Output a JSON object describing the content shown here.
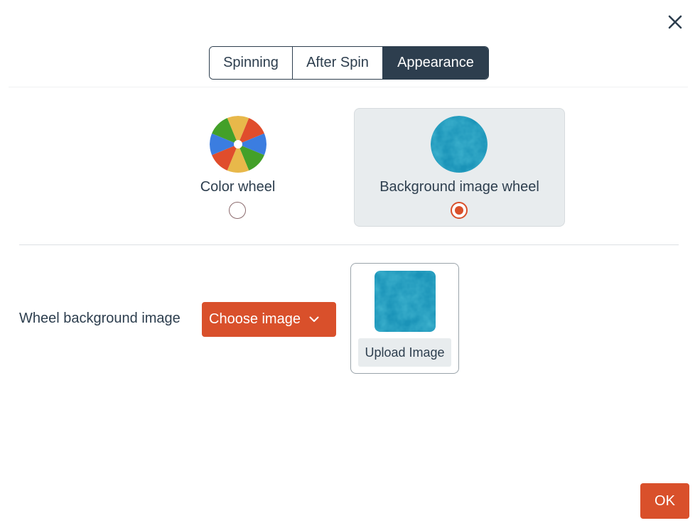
{
  "dialog": {
    "close_icon": "close-icon"
  },
  "tabs": [
    {
      "label": "Spinning",
      "active": false
    },
    {
      "label": "After Spin",
      "active": false
    },
    {
      "label": "Appearance",
      "active": true
    }
  ],
  "appearance": {
    "options": [
      {
        "label": "Color wheel",
        "selected": false,
        "thumbnail": "color-wheel-icon"
      },
      {
        "label": "Background image wheel",
        "selected": true,
        "thumbnail": "ocean-image-thumbnail"
      }
    ],
    "wheel_colors": [
      "#e8b84a",
      "#e04d2c",
      "#3b7de0",
      "#43a029"
    ],
    "background_image_field": {
      "label": "Wheel background image",
      "choose_button": "Choose image",
      "upload_button": "Upload Image"
    }
  },
  "footer": {
    "ok_label": "OK"
  },
  "colors": {
    "accent": "#d9502b",
    "primary": "#2d3e4e",
    "selected_card": "#e8ecee"
  }
}
